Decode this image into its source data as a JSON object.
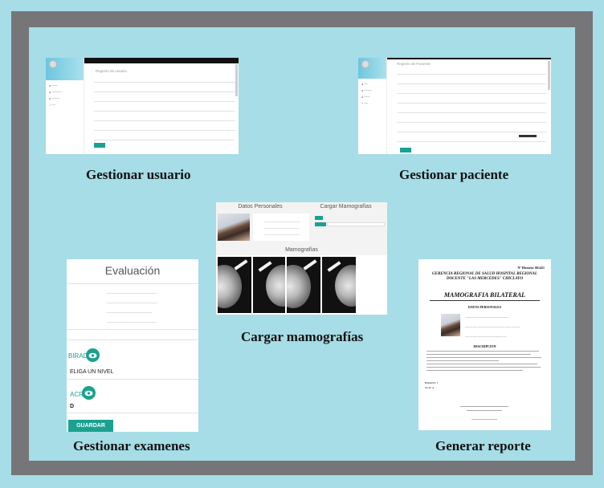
{
  "captions": {
    "gestionar_usuario": "Gestionar usuario",
    "gestionar_paciente": "Gestionar paciente",
    "cargar_mamografias": "Cargar mamografías",
    "gestionar_examenes": "Gestionar examenes",
    "generar_reporte": "Generar reporte"
  },
  "usuario": {
    "form_title": "Registro de usuario"
  },
  "paciente": {
    "form_title": "Registro de Paciente"
  },
  "cargar": {
    "datos_personales": "Datos Personales",
    "cargar_mamografias": "Cargar Mamografías",
    "mamografias": "Mamografías"
  },
  "examenes": {
    "title": "Evaluación",
    "birads_label": "BIRADS",
    "birads_value": "ELIGA UN NIVEL",
    "acr_label": "ACR",
    "acr_value": "D",
    "guardar": "GUARDAR"
  },
  "reporte": {
    "historia": "Nº Historia: 861421",
    "header": "GERENCIA REGIONAL DE SALUD HOSPITAL REGIONAL DOCENTE \"LAS MERCEDES\" CHICLAYO",
    "title": "MAMOGRAFIA BILATERAL",
    "datos_personales": "DATOS PERSONALES",
    "descripcion": "DESCRIPCION",
    "birads": "BIRADS: 1",
    "acr": "ACR: A"
  },
  "colors": {
    "background": "#a6dde6",
    "frame_border": "#767578",
    "teal": "#1aa190"
  }
}
